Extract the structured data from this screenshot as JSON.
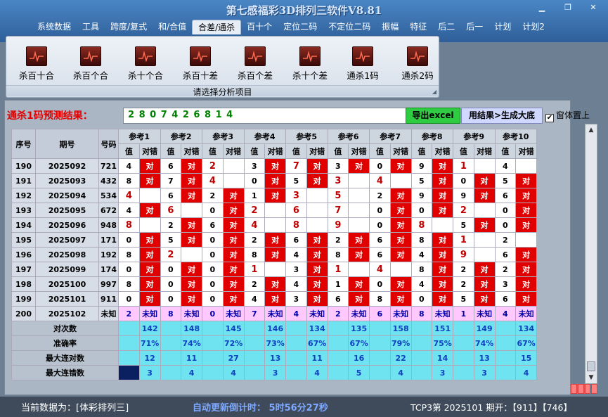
{
  "window": {
    "title": "第七感福彩3D排列三软件V8.81"
  },
  "menu": [
    "系统数据",
    "工具",
    "跨度/复式",
    "和/合值",
    "合差/通杀",
    "百十个",
    "定位二码",
    "不定位二码",
    "振幅",
    "特征",
    "后二",
    "后一",
    "计划",
    "计划2"
  ],
  "menu_active_index": 4,
  "ribbon": {
    "buttons": [
      "杀百十合",
      "杀百个合",
      "杀十个合",
      "杀百十差",
      "杀百个差",
      "杀十个差",
      "通杀1码",
      "通杀2码"
    ],
    "caption": "请选择分析项目"
  },
  "prediction": {
    "label": "通杀1码预测结果：",
    "value": "2 8 0 7 4 2 6 8 1 4",
    "export_label": "导出excel",
    "generate_label": "用结果>生成大底",
    "ontop_label": "窗体置上",
    "ontop_checked": "✔"
  },
  "table": {
    "headers": {
      "seq": "序号",
      "period": "期号",
      "number": "号码",
      "val": "值",
      "res": "对错"
    },
    "refs": [
      "参考1",
      "参考2",
      "参考3",
      "参考4",
      "参考5",
      "参考6",
      "参考7",
      "参考8",
      "参考9",
      "参考10"
    ],
    "rows": [
      {
        "seq": "190",
        "period": "2025092",
        "number": "721",
        "vals": [
          "4",
          "6",
          "2",
          "3",
          "7",
          "3",
          "0",
          "9",
          "1",
          "4"
        ],
        "hot": [
          0,
          0,
          1,
          0,
          1,
          0,
          0,
          0,
          1,
          0
        ],
        "res": [
          "对",
          "对",
          "",
          "对",
          "对",
          "对",
          "对",
          "对",
          "",
          ""
        ]
      },
      {
        "seq": "191",
        "period": "2025093",
        "number": "432",
        "vals": [
          "8",
          "7",
          "4",
          "0",
          "5",
          "3",
          "4",
          "5",
          "0",
          "5"
        ],
        "hot": [
          0,
          0,
          1,
          0,
          0,
          1,
          1,
          0,
          0,
          0
        ],
        "res": [
          "对",
          "对",
          "",
          "对",
          "对",
          "",
          "",
          "对",
          "对",
          "对"
        ]
      },
      {
        "seq": "192",
        "period": "2025094",
        "number": "534",
        "vals": [
          "4",
          "6",
          "2",
          "1",
          "3",
          "5",
          "2",
          "9",
          "9",
          "6"
        ],
        "hot": [
          1,
          0,
          0,
          0,
          1,
          1,
          0,
          0,
          0,
          0
        ],
        "res": [
          "",
          "对",
          "对",
          "对",
          "",
          "",
          "对",
          "对",
          "对",
          "对"
        ]
      },
      {
        "seq": "193",
        "period": "2025095",
        "number": "672",
        "vals": [
          "4",
          "6",
          "0",
          "2",
          "6",
          "7",
          "0",
          "0",
          "2",
          "0"
        ],
        "hot": [
          0,
          1,
          0,
          1,
          1,
          1,
          0,
          0,
          1,
          0
        ],
        "res": [
          "对",
          "",
          "对",
          "",
          "",
          "",
          "对",
          "对",
          "",
          "对"
        ]
      },
      {
        "seq": "194",
        "period": "2025096",
        "number": "948",
        "vals": [
          "8",
          "2",
          "6",
          "4",
          "8",
          "9",
          "0",
          "8",
          "5",
          "0"
        ],
        "hot": [
          1,
          0,
          0,
          1,
          1,
          1,
          0,
          1,
          0,
          0
        ],
        "res": [
          "",
          "对",
          "对",
          "",
          "",
          "",
          "对",
          "",
          "对",
          "对"
        ]
      },
      {
        "seq": "195",
        "period": "2025097",
        "number": "171",
        "vals": [
          "0",
          "5",
          "0",
          "2",
          "6",
          "2",
          "6",
          "8",
          "1",
          "2"
        ],
        "hot": [
          0,
          0,
          0,
          0,
          0,
          0,
          0,
          0,
          1,
          0
        ],
        "res": [
          "对",
          "对",
          "对",
          "对",
          "对",
          "对",
          "对",
          "对",
          "",
          ""
        ]
      },
      {
        "seq": "196",
        "period": "2025098",
        "number": "192",
        "vals": [
          "8",
          "2",
          "0",
          "8",
          "4",
          "8",
          "6",
          "4",
          "9",
          "6"
        ],
        "hot": [
          0,
          1,
          0,
          0,
          0,
          0,
          0,
          0,
          1,
          0
        ],
        "res": [
          "对",
          "",
          "对",
          "对",
          "对",
          "对",
          "对",
          "对",
          "",
          "对"
        ]
      },
      {
        "seq": "197",
        "period": "2025099",
        "number": "174",
        "vals": [
          "0",
          "0",
          "0",
          "1",
          "3",
          "1",
          "4",
          "8",
          "2",
          "2"
        ],
        "hot": [
          0,
          0,
          0,
          1,
          0,
          1,
          1,
          0,
          0,
          0
        ],
        "res": [
          "对",
          "对",
          "对",
          "",
          "对",
          "",
          "",
          "对",
          "对",
          "对"
        ]
      },
      {
        "seq": "198",
        "period": "2025100",
        "number": "997",
        "vals": [
          "8",
          "0",
          "0",
          "2",
          "4",
          "1",
          "0",
          "4",
          "2",
          "3"
        ],
        "hot": [
          0,
          0,
          0,
          0,
          0,
          0,
          0,
          0,
          0,
          0
        ],
        "res": [
          "对",
          "对",
          "对",
          "对",
          "对",
          "对",
          "对",
          "对",
          "对",
          "对"
        ]
      },
      {
        "seq": "199",
        "period": "2025101",
        "number": "911",
        "vals": [
          "0",
          "0",
          "0",
          "4",
          "3",
          "6",
          "8",
          "0",
          "5",
          "6"
        ],
        "hot": [
          0,
          0,
          0,
          0,
          0,
          0,
          0,
          0,
          0,
          0
        ],
        "res": [
          "对",
          "对",
          "对",
          "对",
          "对",
          "对",
          "对",
          "对",
          "对",
          "对"
        ]
      }
    ],
    "unknown_row": {
      "seq": "200",
      "period": "2025102",
      "number": "未知",
      "vals": [
        "2",
        "8",
        "0",
        "7",
        "4",
        "2",
        "6",
        "8",
        "1",
        "4"
      ],
      "res_label": "未知"
    },
    "stats": [
      {
        "label": "对次数",
        "values": [
          "142",
          "148",
          "145",
          "146",
          "134",
          "135",
          "158",
          "151",
          "149",
          "134"
        ]
      },
      {
        "label": "准确率",
        "values": [
          "71%",
          "74%",
          "72%",
          "73%",
          "67%",
          "67%",
          "79%",
          "75%",
          "74%",
          "67%"
        ]
      },
      {
        "label": "最大连对数",
        "values": [
          "12",
          "11",
          "27",
          "13",
          "11",
          "16",
          "22",
          "14",
          "13",
          "15"
        ]
      },
      {
        "label": "最大连错数",
        "values": [
          "3",
          "4",
          "4",
          "3",
          "4",
          "5",
          "4",
          "3",
          "3",
          "4"
        ]
      }
    ]
  },
  "status": {
    "current": "当前数据为：[体彩排列三]",
    "countdown": "自动更新倒计时： 5时56分27秒",
    "issue": "TCP3第 2025101 期开：【911】【746】"
  }
}
